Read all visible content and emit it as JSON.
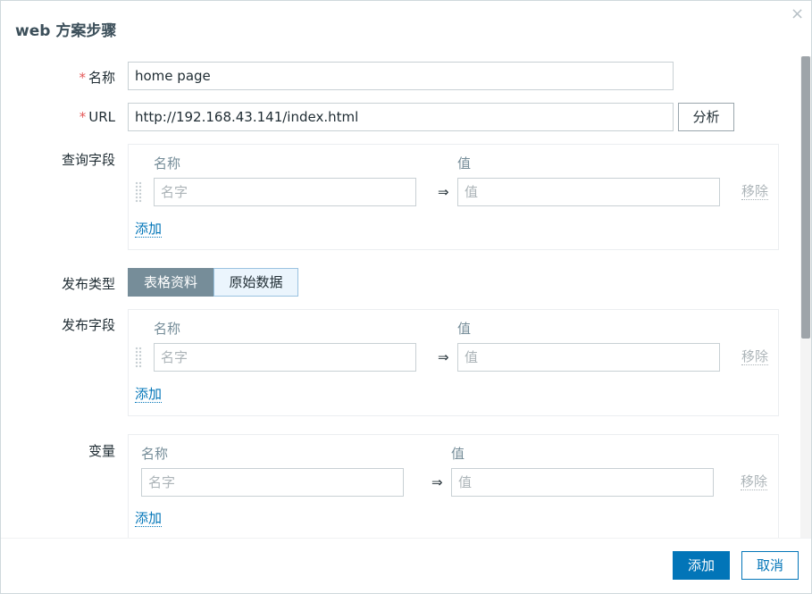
{
  "dialog": {
    "title": "web 方案步骤",
    "close_icon": "×"
  },
  "form": {
    "required_mark": "*",
    "name_label": "名称",
    "name_value": "home page",
    "url_label": "URL",
    "url_value": "http://192.168.43.141/index.html",
    "parse_button": "分析",
    "query_fields_label": "查询字段",
    "post_type_label": "发布类型",
    "post_type_options": [
      "表格资料",
      "原始数据"
    ],
    "post_fields_label": "发布字段",
    "variables_label": "变量"
  },
  "pair_table": {
    "name_header": "名称",
    "value_header": "值",
    "name_placeholder": "名字",
    "value_placeholder": "值",
    "arrow": "⇒",
    "remove_label": "移除",
    "add_label": "添加"
  },
  "footer": {
    "add_button": "添加",
    "cancel_button": "取消"
  },
  "colors": {
    "primary": "#0275b8",
    "segment_active": "#768d99",
    "required": "#e45959"
  }
}
